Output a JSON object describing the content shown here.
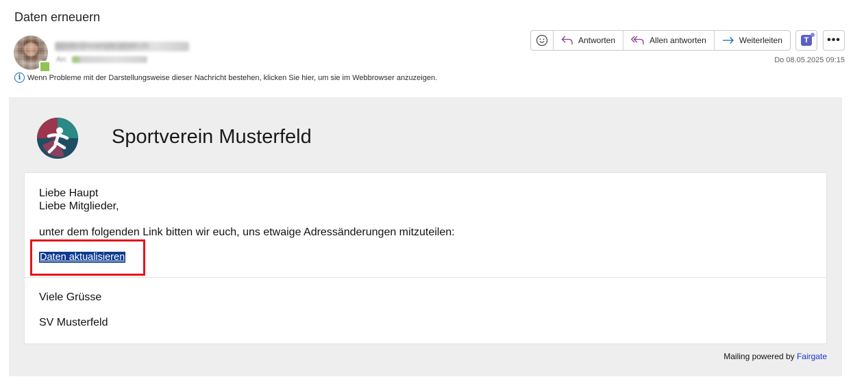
{
  "email": {
    "subject": "Daten erneuern",
    "sender_display": "sender@example-verein.ch",
    "to_label": "An:",
    "date": "Do 08.05.2025 09:15",
    "info_bar": "Wenn Probleme mit der Darstellungsweise dieser Nachricht bestehen, klicken Sie hier, um sie im Webbrowser anzuzeigen."
  },
  "toolbar": {
    "reply": "Antworten",
    "reply_all": "Allen antworten",
    "forward": "Weiterleiten",
    "teams_letter": "T",
    "more": "•••"
  },
  "body": {
    "org_name": "Sportverein Musterfeld",
    "greeting_1": "Liebe Haupt",
    "greeting_2": "Liebe Mitglieder,",
    "intro": "unter dem folgenden Link bitten wir euch, uns etwaige Adressänderungen mitzuteilen:",
    "link_text": "Daten aktualisieren",
    "closing": "Viele Grüsse",
    "signature": "SV Musterfeld",
    "powered_prefix": "Mailing powered by",
    "powered_link": "Fairgate"
  },
  "colors": {
    "selection": "#0c3b90",
    "annotation_box": "#e3141a",
    "link": "#1a33d6",
    "reply_icon": "#8b3b8c",
    "forward_icon": "#0f6cbd"
  }
}
